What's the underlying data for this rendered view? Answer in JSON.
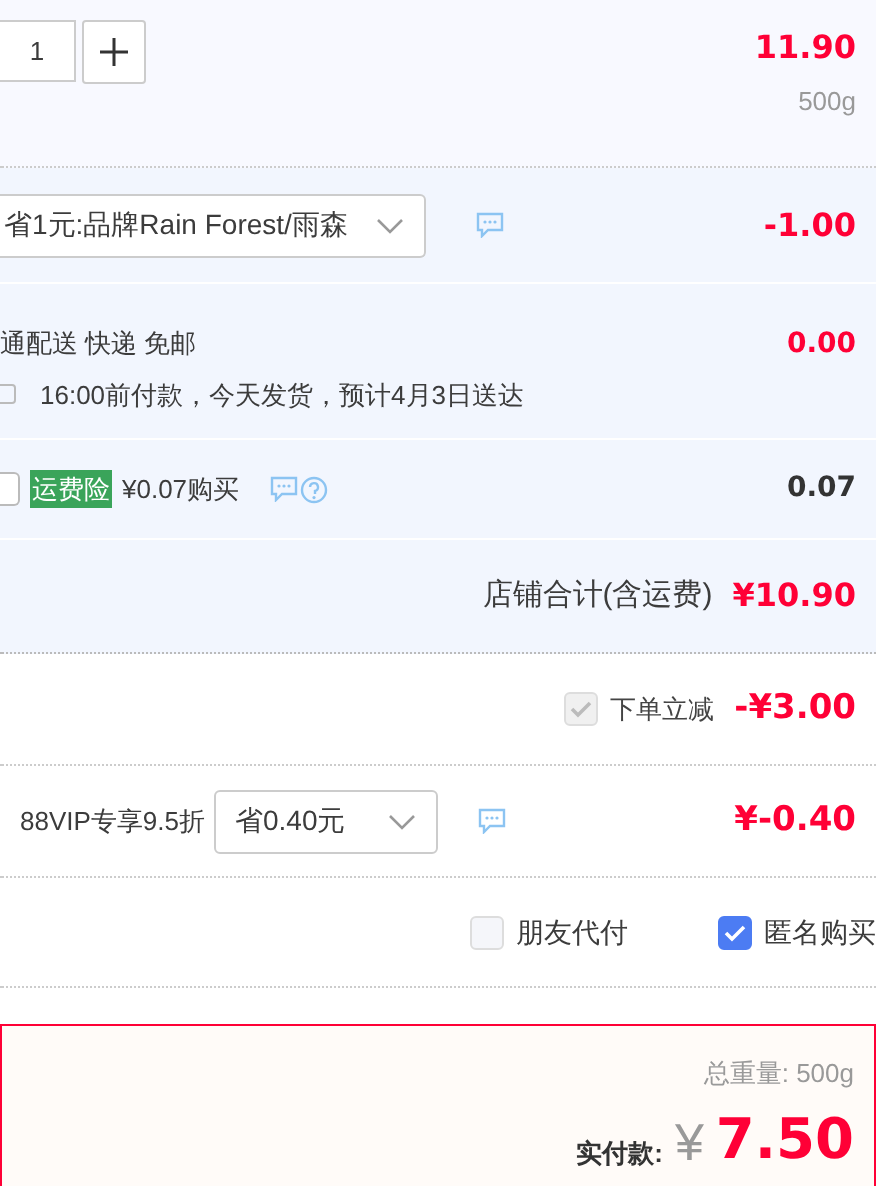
{
  "item": {
    "quantity": "1",
    "price": "11.90",
    "weight": "500g"
  },
  "shop_discount": {
    "option": "省1元:品牌Rain Forest/雨森",
    "amount": "-1.00"
  },
  "delivery": {
    "method": "通配送 快递 免邮",
    "note": "16:00前付款，今天发货，预计4月3日送达",
    "amount": "0.00"
  },
  "insurance": {
    "checked": false,
    "badge": "运费险",
    "price": "¥0.07购买",
    "amount": "0.07"
  },
  "shop_total": {
    "label": "店铺合计(含运费)",
    "amount": "¥10.90"
  },
  "instant_discount": {
    "label": "下单立减",
    "checked": true,
    "disabled": true,
    "amount": "-¥3.00"
  },
  "vip": {
    "label": "88VIP专享9.5折",
    "option": "省0.40元",
    "amount": "¥-0.40"
  },
  "options": [
    {
      "label": "朋友代付",
      "checked": false
    },
    {
      "label": "匿名购买",
      "checked": true
    }
  ],
  "summary": {
    "weight_label": "总重量:",
    "weight": "500g",
    "pay_label": "实付款:",
    "currency": "¥",
    "total": "7.50"
  }
}
